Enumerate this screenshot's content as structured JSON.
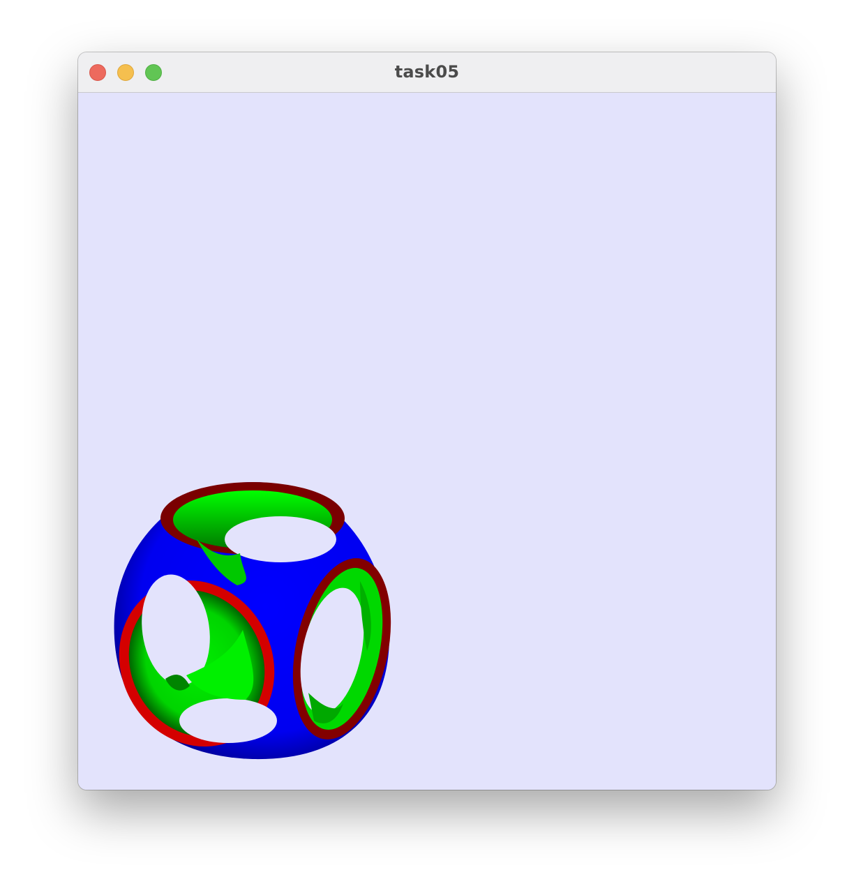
{
  "window": {
    "title": "task05"
  },
  "canvas": {
    "background": "#e3e3fc",
    "object": "cube-sphere-with-torus-holes",
    "colors": {
      "body": "#0000ff",
      "inner": "#00e800",
      "rim_front": "#d00000",
      "rim_dark": "#800000"
    }
  }
}
